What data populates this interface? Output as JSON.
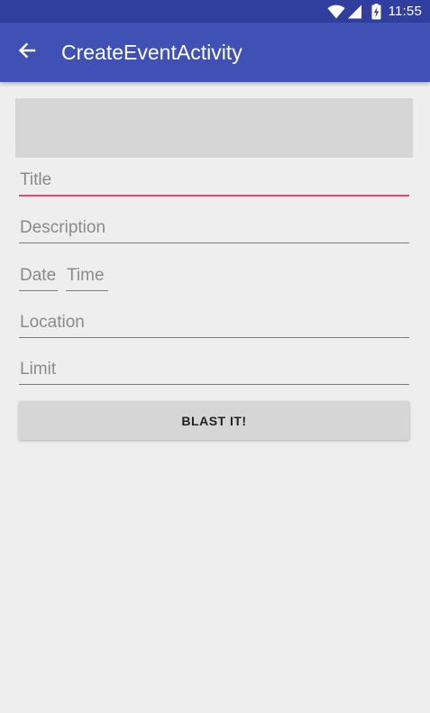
{
  "status_bar": {
    "time": "11:55",
    "icons": [
      "wifi-icon",
      "signal-icon",
      "battery-charging-icon"
    ]
  },
  "app_bar": {
    "title": "CreateEventActivity",
    "back_icon": "arrow-back-icon"
  },
  "form": {
    "title": {
      "placeholder": "Title",
      "value": ""
    },
    "description": {
      "placeholder": "Description",
      "value": ""
    },
    "date": {
      "placeholder": "Date",
      "value": ""
    },
    "time": {
      "placeholder": "Time",
      "value": ""
    },
    "location": {
      "placeholder": "Location",
      "value": ""
    },
    "limit": {
      "placeholder": "Limit",
      "value": ""
    },
    "submit_label": "BLAST IT!"
  },
  "colors": {
    "status_bar": "#303f9f",
    "app_bar": "#3f51b5",
    "accent": "#ec407a",
    "background": "#eeeeee",
    "placeholder_box": "#d6d6d6"
  }
}
